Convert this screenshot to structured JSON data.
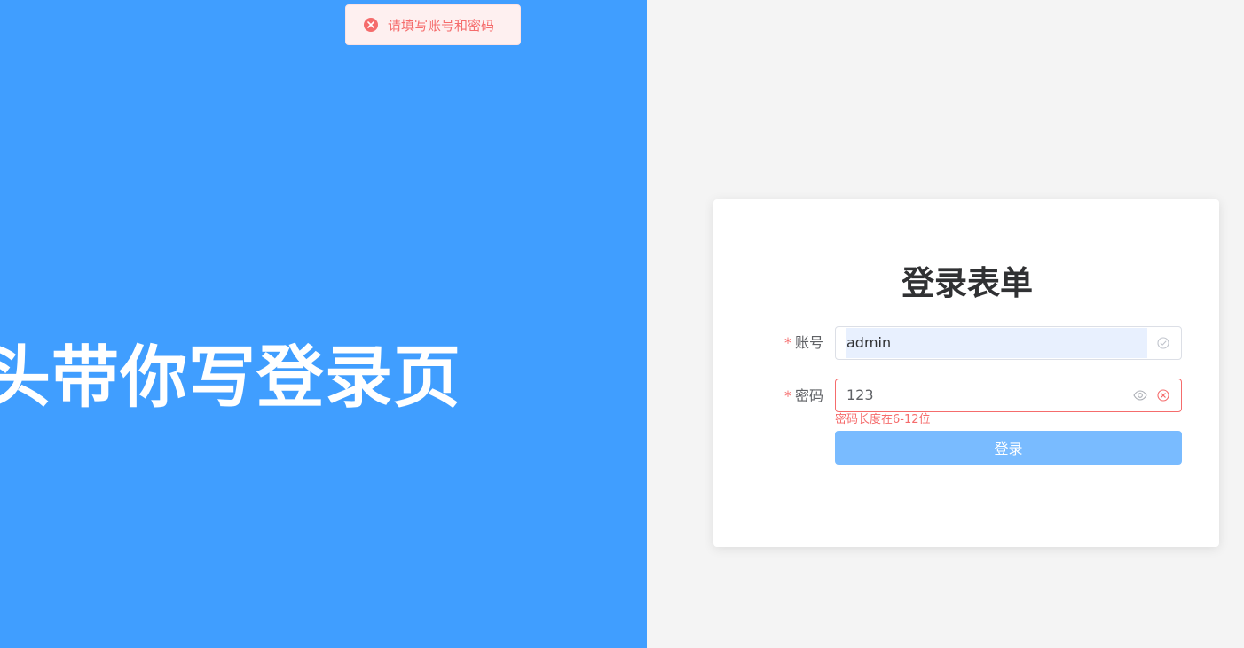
{
  "hero": {
    "title": "石头带你写登录页"
  },
  "toast": {
    "icon": "error-circle-icon",
    "message": "请填写账号和密码",
    "color": "#f56c6c"
  },
  "login_form": {
    "title": "登录表单",
    "account": {
      "required_mark": "*",
      "label": "账号",
      "value": "admin",
      "status_icon": "check-circle-icon"
    },
    "password": {
      "required_mark": "*",
      "label": "密码",
      "value": "123",
      "toggle_icon": "eye-icon",
      "status_icon": "error-circle-icon",
      "error": "密码长度在6-12位"
    },
    "submit_label": "登录"
  },
  "colors": {
    "primary": "#409eff",
    "button_disabled": "#79bbff",
    "danger": "#f56c6c",
    "page_bg": "#f4f4f4"
  }
}
